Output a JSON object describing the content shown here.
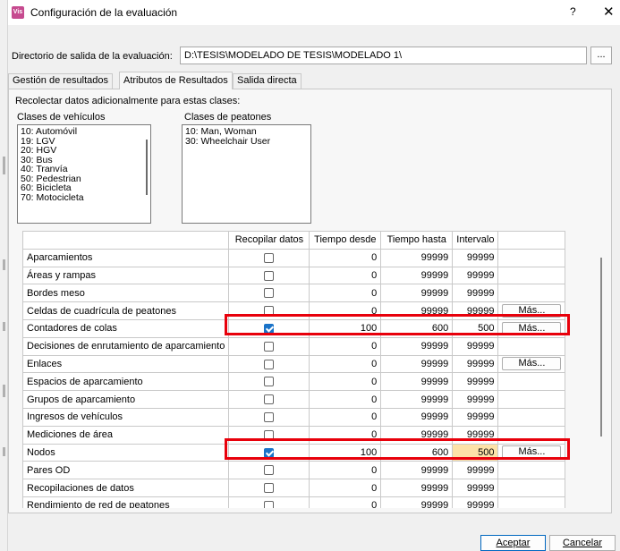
{
  "window": {
    "title": "Configuración de la evaluación",
    "app_icon_text": "Vis",
    "help_label": "?",
    "close_label": "✕",
    "icon_color": "#c64a8f"
  },
  "directory": {
    "label": "Directorio de salida de la evaluación:",
    "value": "D:\\TESIS\\MODELADO DE TESIS\\MODELADO 1\\",
    "browse_label": "..."
  },
  "tabs": [
    {
      "label": "Gestión de resultados"
    },
    {
      "label": "Atributos de Resultados",
      "active": true
    },
    {
      "label": "Salida directa"
    }
  ],
  "collect_label": "Recolectar datos adicionalmente para estas clases:",
  "vehicle_classes": {
    "label": "Clases de vehículos",
    "items": [
      "10: Automóvil",
      "19: LGV",
      "20: HGV",
      "30: Bus",
      "40: Tranvía",
      "50: Pedestrian",
      "60: Bicicleta",
      "70: Motocicleta"
    ]
  },
  "pedestrian_classes": {
    "label": "Clases de peatones",
    "items": [
      "10: Man, Woman",
      "30: Wheelchair User"
    ]
  },
  "grid": {
    "headers": [
      "",
      "Recopilar datos",
      "Tiempo desde",
      "Tiempo hasta",
      "Intervalo",
      ""
    ],
    "rows": [
      {
        "name": "Aparcamientos",
        "checked": false,
        "from": "0",
        "to": "99999",
        "interval": "99999",
        "more": ""
      },
      {
        "name": "Áreas y rampas",
        "checked": false,
        "from": "0",
        "to": "99999",
        "interval": "99999",
        "more": ""
      },
      {
        "name": "Bordes meso",
        "checked": false,
        "from": "0",
        "to": "99999",
        "interval": "99999",
        "more": ""
      },
      {
        "name": "Celdas de cuadrícula de peatones",
        "checked": false,
        "from": "0",
        "to": "99999",
        "interval": "99999",
        "more": "Más..."
      },
      {
        "name": "Contadores de colas",
        "checked": true,
        "from": "100",
        "to": "600",
        "interval": "500",
        "more": "Más..."
      },
      {
        "name": "Decisiones de enrutamiento de aparcamiento",
        "checked": false,
        "from": "0",
        "to": "99999",
        "interval": "99999",
        "more": ""
      },
      {
        "name": "Enlaces",
        "checked": false,
        "from": "0",
        "to": "99999",
        "interval": "99999",
        "more": "Más..."
      },
      {
        "name": "Espacios de aparcamiento",
        "checked": false,
        "from": "0",
        "to": "99999",
        "interval": "99999",
        "more": ""
      },
      {
        "name": "Grupos de aparcamiento",
        "checked": false,
        "from": "0",
        "to": "99999",
        "interval": "99999",
        "more": ""
      },
      {
        "name": "Ingresos de vehículos",
        "checked": false,
        "from": "0",
        "to": "99999",
        "interval": "99999",
        "more": ""
      },
      {
        "name": "Mediciones de área",
        "checked": false,
        "from": "0",
        "to": "99999",
        "interval": "99999",
        "more": ""
      },
      {
        "name": "Nodos",
        "checked": true,
        "from": "100",
        "to": "600",
        "interval": "500",
        "more": "Más...",
        "interval_highlight": true
      },
      {
        "name": "Pares OD",
        "checked": false,
        "from": "0",
        "to": "99999",
        "interval": "99999",
        "more": ""
      },
      {
        "name": "Recopilaciones de datos",
        "checked": false,
        "from": "0",
        "to": "99999",
        "interval": "99999",
        "more": ""
      },
      {
        "name": "Rendimiento de red de peatones",
        "checked": false,
        "from": "0",
        "to": "99999",
        "interval": "99999",
        "more": ""
      }
    ]
  },
  "colors": {
    "highlight_box": "#e8000b",
    "checkbox_checked": "#1a73c8",
    "interval_highlight": "#fde2a8"
  },
  "buttons": {
    "ok_label": "Aceptar",
    "cancel_label": "Cancelar"
  }
}
